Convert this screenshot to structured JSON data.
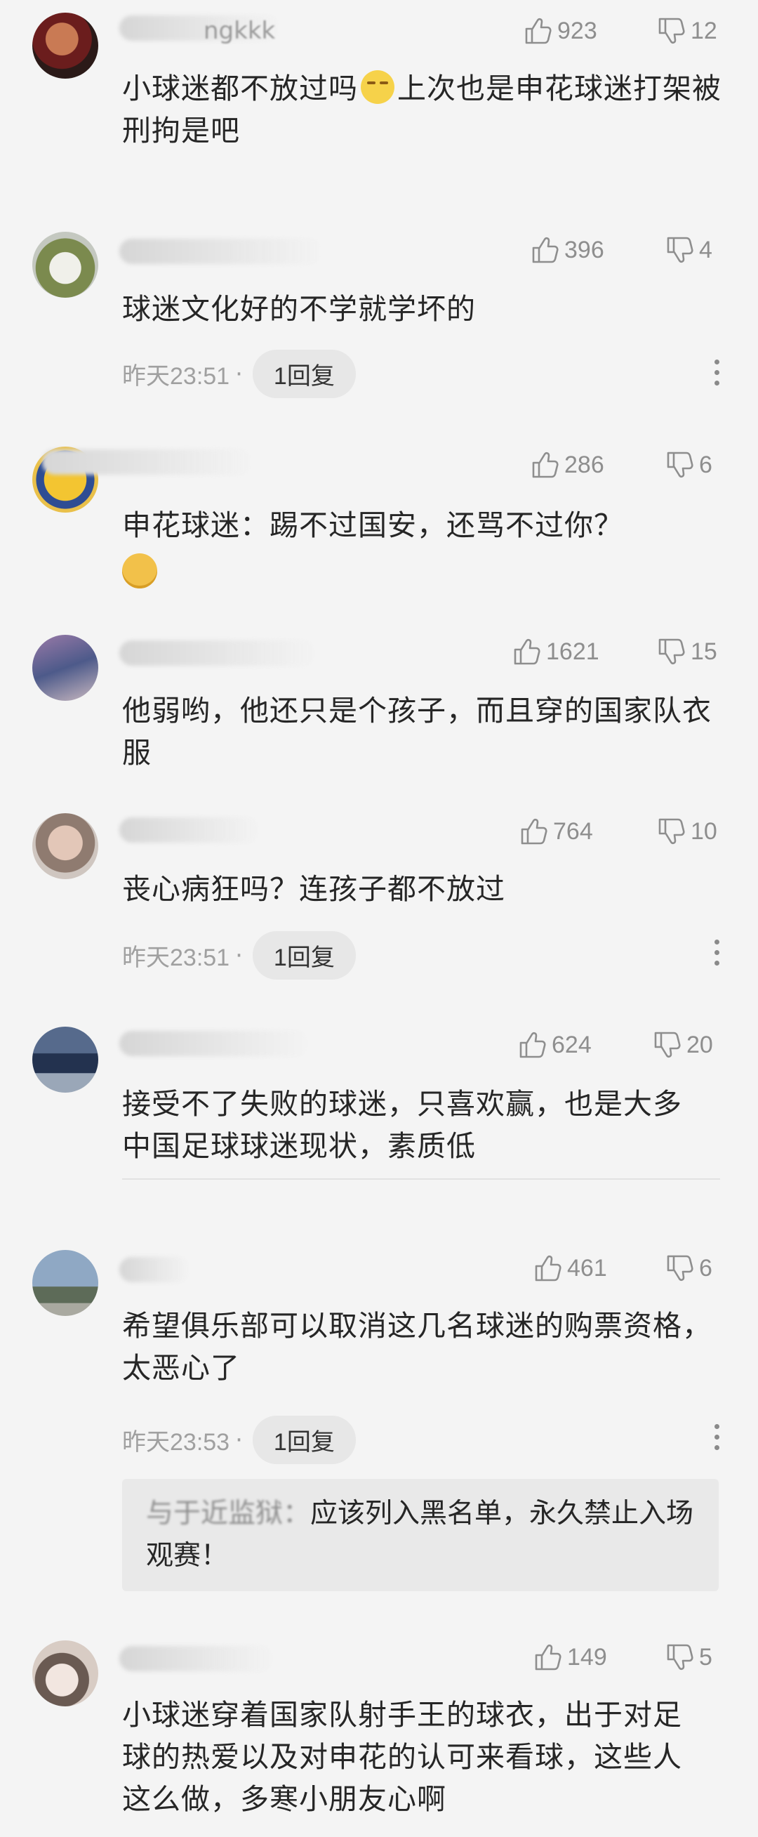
{
  "icons": {
    "like": "thumbs-up-icon",
    "dislike": "thumbs-down-icon",
    "more": "more-vertical-icon"
  },
  "colors": {
    "background": "#f4f4f4",
    "muted": "#8e8e8e",
    "reply_bg": "#e7e7e7"
  },
  "comments": [
    {
      "nick": "ngkkk",
      "likes": "923",
      "dislikes": "12",
      "text": "小球迷都不放过吗",
      "text_after_emoji": "上次也是申花球迷打架被刑拘是吧"
    },
    {
      "likes": "396",
      "dislikes": "4",
      "text": "球迷文化好的不学就学坏的",
      "time": "昨天23:51",
      "dot": "·",
      "reply": "1回复"
    },
    {
      "likes": "286",
      "dislikes": "6",
      "text": "申花球迷：踢不过国安，还骂不过你？"
    },
    {
      "likes": "1621",
      "dislikes": "15",
      "text": "他弱哟，他还只是个孩子，而且穿的国家队衣服"
    },
    {
      "likes": "764",
      "dislikes": "10",
      "text": "丧心病狂吗？连孩子都不放过",
      "time": "昨天23:51",
      "dot": "·",
      "reply": "1回复"
    },
    {
      "likes": "624",
      "dislikes": "20",
      "text": "接受不了失败的球迷，只喜欢赢，也是大多中国足球球迷现状，素质低"
    },
    {
      "likes": "461",
      "dislikes": "6",
      "text": "希望俱乐部可以取消这几名球迷的购票资格，太恶心了",
      "time": "昨天23:53",
      "dot": "·",
      "reply": "1回复",
      "sub_reply": {
        "nick": "与于近监狱：",
        "text": "应该列入黑名单，永久禁止入场观赛！"
      }
    },
    {
      "likes": "149",
      "dislikes": "5",
      "text": "小球迷穿着国家队射手王的球衣，出于对足球的热爱以及对申花的认可来看球，这些人这么做，多寒小朋友心啊"
    }
  ]
}
